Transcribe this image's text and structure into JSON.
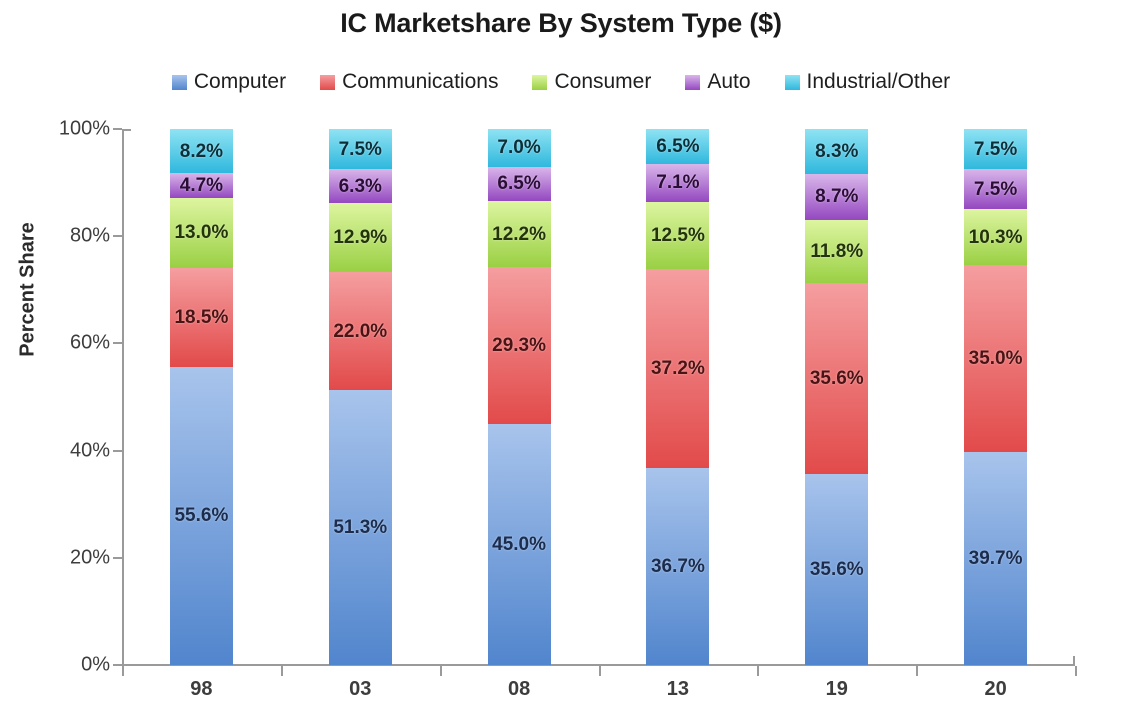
{
  "chart_data": {
    "type": "bar",
    "subtype": "stacked-percent",
    "title": "IC Marketshare By System Type ($)",
    "xlabel": "",
    "ylabel": "Percent Share",
    "categories": [
      "98",
      "03",
      "08",
      "13",
      "19",
      "20"
    ],
    "ylim": [
      0,
      100
    ],
    "ytick_labels": [
      "0%",
      "20%",
      "40%",
      "60%",
      "80%",
      "100%"
    ],
    "ytick_values": [
      0,
      20,
      40,
      60,
      80,
      100
    ],
    "grid": false,
    "legend_position": "top",
    "series": [
      {
        "name": "Computer",
        "color": "#6699dd",
        "color_top": "#a8c4ec",
        "color_bottom": "#5185cd",
        "label_class": "label-navy",
        "values": [
          55.6,
          51.3,
          45.0,
          36.7,
          35.6,
          39.7
        ],
        "labels": [
          "55.6%",
          "51.3%",
          "45.0%",
          "36.7%",
          "35.6%",
          "39.7%"
        ]
      },
      {
        "name": "Communications",
        "color": "#e8555a",
        "color_top": "#f59ea0",
        "color_bottom": "#e24a4a",
        "label_class": "label-maroon",
        "values": [
          18.5,
          22.0,
          29.3,
          37.2,
          35.6,
          35.0
        ],
        "labels": [
          "18.5%",
          "22.0%",
          "29.3%",
          "37.2%",
          "35.6%",
          "35.0%"
        ]
      },
      {
        "name": "Consumer",
        "color": "#a5d martin",
        "color_top": "#ddf5a0",
        "color_bottom": "#9ad044",
        "label_class": "label-olive",
        "values": [
          13.0,
          12.9,
          12.2,
          12.5,
          11.8,
          10.3
        ],
        "labels": [
          "13.0%",
          "12.9%",
          "12.2%",
          "12.5%",
          "11.8%",
          "10.3%"
        ]
      },
      {
        "name": "Auto",
        "color": "#9b59c6",
        "color_top": "#d9b6ea",
        "color_bottom": "#9448c0",
        "label_class": "label-plum",
        "values": [
          4.7,
          6.3,
          6.5,
          7.1,
          8.7,
          7.5
        ],
        "labels": [
          "4.7%",
          "6.3%",
          "6.5%",
          "7.1%",
          "8.7%",
          "7.5%"
        ]
      },
      {
        "name": "Industrial/Other",
        "color": "#3fc0e0",
        "color_top": "#8fe3f3",
        "color_bottom": "#2fb8dd",
        "label_class": "label-teal",
        "values": [
          8.2,
          7.5,
          7.0,
          6.5,
          8.3,
          7.5
        ],
        "labels": [
          "8.2%",
          "7.5%",
          "7.0%",
          "6.5%",
          "8.3%",
          "7.5%"
        ]
      }
    ]
  },
  "legend": {
    "items": [
      {
        "label": "Computer"
      },
      {
        "label": "Communications"
      },
      {
        "label": "Consumer"
      },
      {
        "label": "Auto"
      },
      {
        "label": "Industrial/Other"
      }
    ]
  }
}
